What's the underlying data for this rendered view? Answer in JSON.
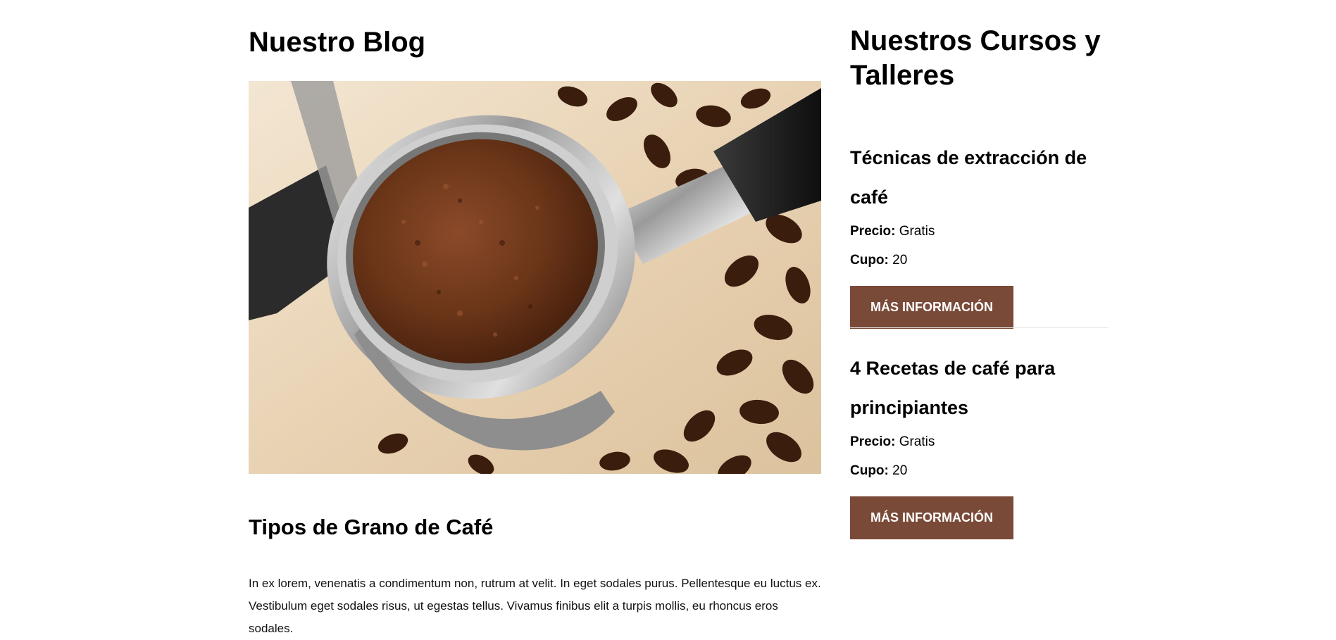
{
  "blog": {
    "heading": "Nuestro Blog",
    "post": {
      "title": "Tipos de Grano de Café",
      "excerpt": "In ex lorem, venenatis a condimentum non, rutrum at velit. In eget sodales purus. Pellentesque eu luctus ex. Vestibulum eget sodales risus, ut egestas tellus. Vivamus finibus elit a turpis mollis, eu rhoncus eros sodales."
    }
  },
  "courses": {
    "heading": "Nuestros Cursos y Talleres",
    "items": [
      {
        "title": "Técnicas de extracción de café",
        "price_label": "Precio:",
        "price_value": "Gratis",
        "seats_label": "Cupo:",
        "seats_value": "20",
        "button_label": "MÁS INFORMACIÓN"
      },
      {
        "title": "4 Recetas de café para principiantes",
        "price_label": "Precio:",
        "price_value": "Gratis",
        "seats_label": "Cupo:",
        "seats_value": "20",
        "button_label": "MÁS INFORMACIÓN"
      }
    ]
  },
  "colors": {
    "button": "#7a4a38",
    "divider": "#e6e6e6"
  }
}
